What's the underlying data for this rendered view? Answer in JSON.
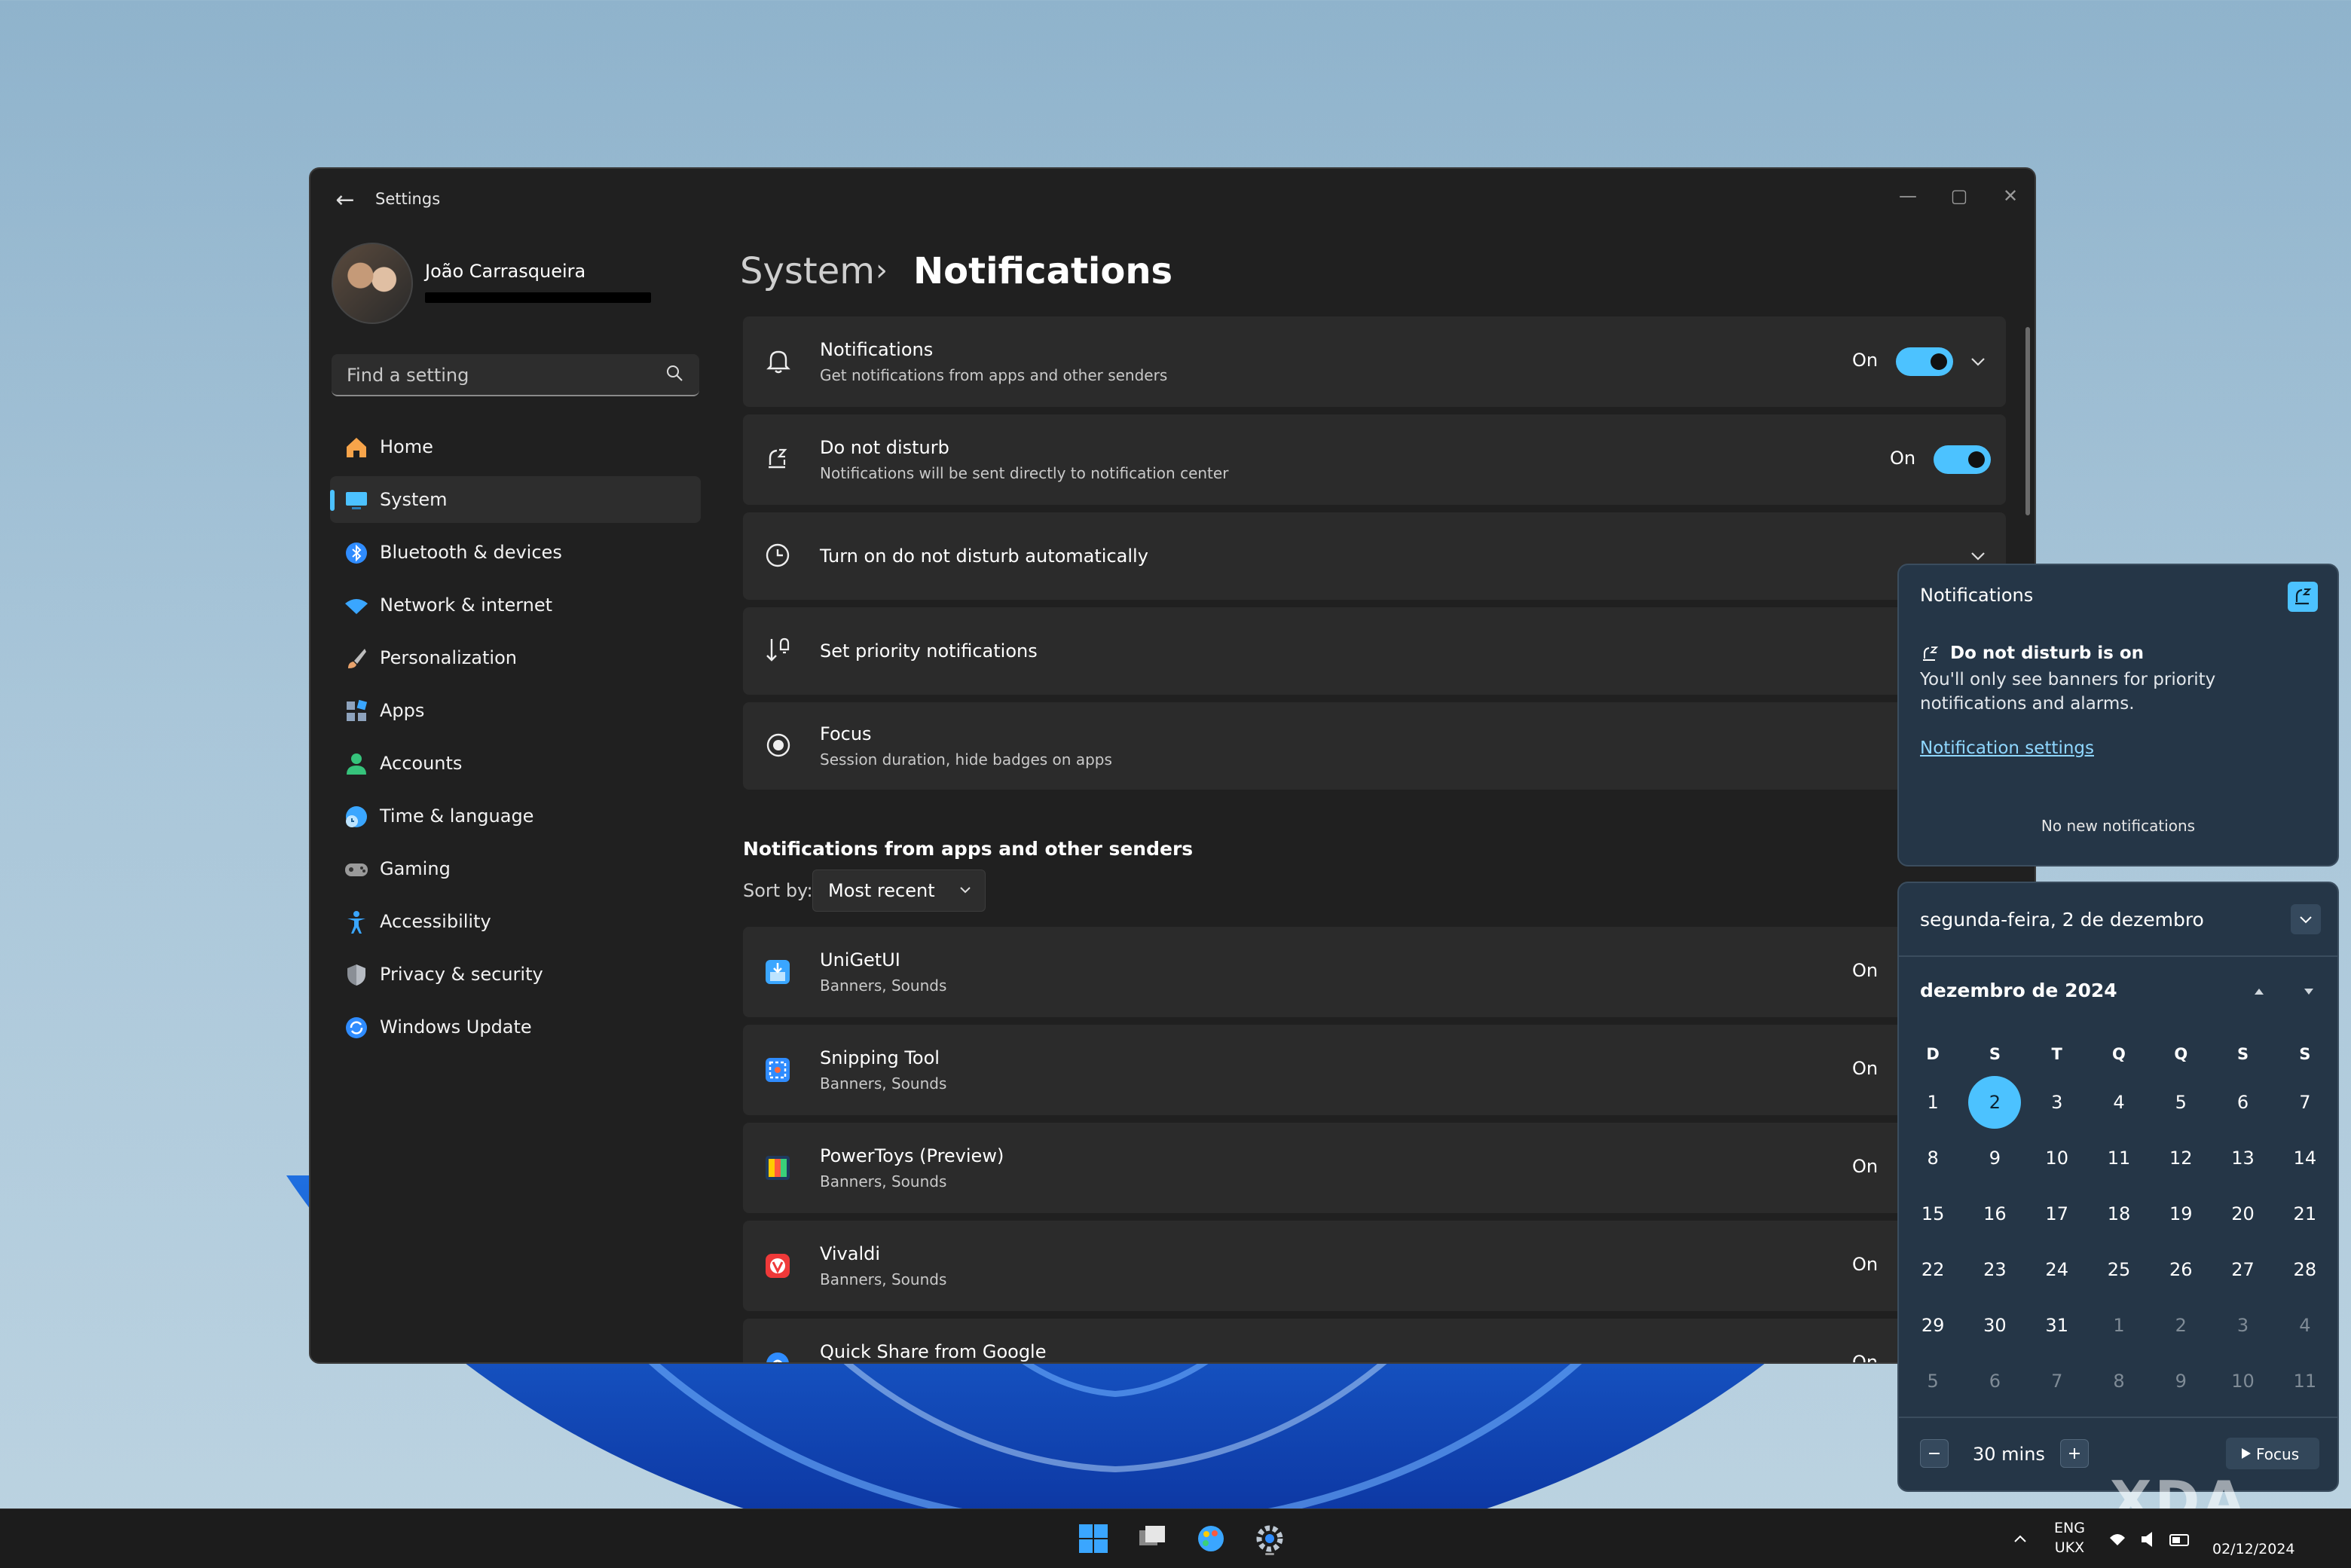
{
  "window": {
    "title": "Settings",
    "user_name": "João Carrasqueira",
    "search_placeholder": "Find a setting"
  },
  "nav": [
    {
      "label": "Home",
      "icon": "home-icon",
      "color": "#f7a44a"
    },
    {
      "label": "System",
      "icon": "system-icon",
      "color": "#4cc2ff"
    },
    {
      "label": "Bluetooth & devices",
      "icon": "bluetooth-icon",
      "color": "#2f8cff"
    },
    {
      "label": "Network & internet",
      "icon": "wifi-icon",
      "color": "#3aa6ff"
    },
    {
      "label": "Personalization",
      "icon": "brush-icon",
      "color": "#e8a26b"
    },
    {
      "label": "Apps",
      "icon": "apps-icon",
      "color": "#8ea3bd"
    },
    {
      "label": "Accounts",
      "icon": "person-icon",
      "color": "#36c37b"
    },
    {
      "label": "Time & language",
      "icon": "globe-clock-icon",
      "color": "#3aa6ff"
    },
    {
      "label": "Gaming",
      "icon": "gamepad-icon",
      "color": "#9a9a9a"
    },
    {
      "label": "Accessibility",
      "icon": "accessibility-icon",
      "color": "#3aa6ff"
    },
    {
      "label": "Privacy & security",
      "icon": "shield-icon",
      "color": "#8a8f96"
    },
    {
      "label": "Windows Update",
      "icon": "update-icon",
      "color": "#2f8cff"
    }
  ],
  "breadcrumb": {
    "parent": "System",
    "separator": "›",
    "page": "Notifications"
  },
  "cards": {
    "notifications": {
      "title": "Notifications",
      "subtitle": "Get notifications from apps and other senders",
      "state": "On"
    },
    "dnd": {
      "title": "Do not disturb",
      "subtitle": "Notifications will be sent directly to notification center",
      "state": "On"
    },
    "auto_dnd": {
      "title": "Turn on do not disturb automatically"
    },
    "priority": {
      "title": "Set priority notifications"
    },
    "focus": {
      "title": "Focus",
      "subtitle": "Session duration, hide badges on apps"
    }
  },
  "senders": {
    "section_title": "Notifications from apps and other senders",
    "sort_label": "Sort by:",
    "sort_value": "Most recent",
    "apps": [
      {
        "name": "UniGetUI",
        "subtitle": "Banners, Sounds",
        "state": "On"
      },
      {
        "name": "Snipping Tool",
        "subtitle": "Banners, Sounds",
        "state": "On"
      },
      {
        "name": "PowerToys (Preview)",
        "subtitle": "Banners, Sounds",
        "state": "On"
      },
      {
        "name": "Vivaldi",
        "subtitle": "Banners, Sounds",
        "state": "On"
      },
      {
        "name": "Quick Share from Google",
        "subtitle": "",
        "state": "On"
      }
    ]
  },
  "flyout": {
    "title": "Notifications",
    "dnd_heading": "Do not disturb is on",
    "dnd_desc": "You'll only see banners for priority notifications and alarms.",
    "link": "Notification settings",
    "empty": "No new notifications"
  },
  "calendar": {
    "date_label": "segunda-feira, 2 de dezembro",
    "month_label": "dezembro de 2024",
    "weekdays": [
      "D",
      "S",
      "T",
      "Q",
      "Q",
      "S",
      "S"
    ],
    "weeks": [
      [
        "1",
        "2",
        "3",
        "4",
        "5",
        "6",
        "7"
      ],
      [
        "8",
        "9",
        "10",
        "11",
        "12",
        "13",
        "14"
      ],
      [
        "15",
        "16",
        "17",
        "18",
        "19",
        "20",
        "21"
      ],
      [
        "22",
        "23",
        "24",
        "25",
        "26",
        "27",
        "28"
      ],
      [
        "29",
        "30",
        "31",
        "1",
        "2",
        "3",
        "4"
      ],
      [
        "5",
        "6",
        "7",
        "8",
        "9",
        "10",
        "11"
      ]
    ],
    "today": "2",
    "focus_minutes": "30 mins",
    "focus_label": "Focus"
  },
  "taskbar": {
    "lang_top": "ENG",
    "lang_bottom": "UKX",
    "date": "02/12/2024"
  },
  "watermark": "XDA",
  "colors": {
    "accent": "#4cc2ff",
    "window_bg": "#202020",
    "card_bg": "#2b2b2b",
    "flyout_bg": "#253647"
  }
}
